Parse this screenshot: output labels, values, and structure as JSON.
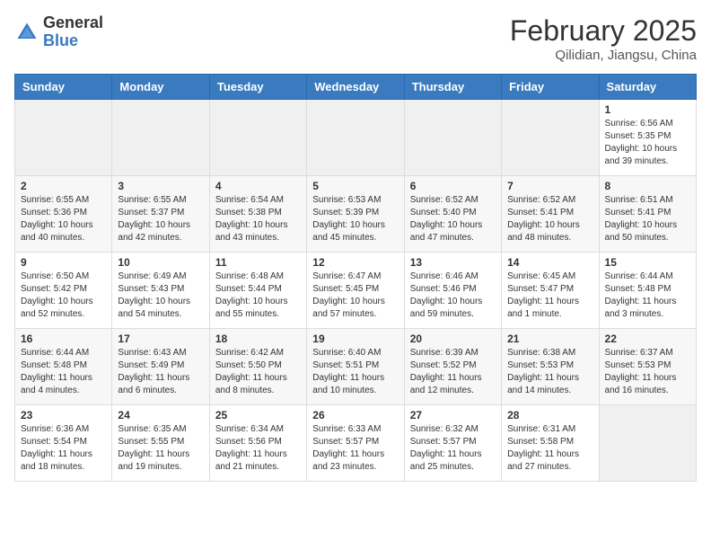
{
  "header": {
    "logo_general": "General",
    "logo_blue": "Blue",
    "month_title": "February 2025",
    "location": "Qilidian, Jiangsu, China"
  },
  "days_of_week": [
    "Sunday",
    "Monday",
    "Tuesday",
    "Wednesday",
    "Thursday",
    "Friday",
    "Saturday"
  ],
  "weeks": [
    [
      {
        "day": "",
        "info": ""
      },
      {
        "day": "",
        "info": ""
      },
      {
        "day": "",
        "info": ""
      },
      {
        "day": "",
        "info": ""
      },
      {
        "day": "",
        "info": ""
      },
      {
        "day": "",
        "info": ""
      },
      {
        "day": "1",
        "info": "Sunrise: 6:56 AM\nSunset: 5:35 PM\nDaylight: 10 hours and 39 minutes."
      }
    ],
    [
      {
        "day": "2",
        "info": "Sunrise: 6:55 AM\nSunset: 5:36 PM\nDaylight: 10 hours and 40 minutes."
      },
      {
        "day": "3",
        "info": "Sunrise: 6:55 AM\nSunset: 5:37 PM\nDaylight: 10 hours and 42 minutes."
      },
      {
        "day": "4",
        "info": "Sunrise: 6:54 AM\nSunset: 5:38 PM\nDaylight: 10 hours and 43 minutes."
      },
      {
        "day": "5",
        "info": "Sunrise: 6:53 AM\nSunset: 5:39 PM\nDaylight: 10 hours and 45 minutes."
      },
      {
        "day": "6",
        "info": "Sunrise: 6:52 AM\nSunset: 5:40 PM\nDaylight: 10 hours and 47 minutes."
      },
      {
        "day": "7",
        "info": "Sunrise: 6:52 AM\nSunset: 5:41 PM\nDaylight: 10 hours and 48 minutes."
      },
      {
        "day": "8",
        "info": "Sunrise: 6:51 AM\nSunset: 5:41 PM\nDaylight: 10 hours and 50 minutes."
      }
    ],
    [
      {
        "day": "9",
        "info": "Sunrise: 6:50 AM\nSunset: 5:42 PM\nDaylight: 10 hours and 52 minutes."
      },
      {
        "day": "10",
        "info": "Sunrise: 6:49 AM\nSunset: 5:43 PM\nDaylight: 10 hours and 54 minutes."
      },
      {
        "day": "11",
        "info": "Sunrise: 6:48 AM\nSunset: 5:44 PM\nDaylight: 10 hours and 55 minutes."
      },
      {
        "day": "12",
        "info": "Sunrise: 6:47 AM\nSunset: 5:45 PM\nDaylight: 10 hours and 57 minutes."
      },
      {
        "day": "13",
        "info": "Sunrise: 6:46 AM\nSunset: 5:46 PM\nDaylight: 10 hours and 59 minutes."
      },
      {
        "day": "14",
        "info": "Sunrise: 6:45 AM\nSunset: 5:47 PM\nDaylight: 11 hours and 1 minute."
      },
      {
        "day": "15",
        "info": "Sunrise: 6:44 AM\nSunset: 5:48 PM\nDaylight: 11 hours and 3 minutes."
      }
    ],
    [
      {
        "day": "16",
        "info": "Sunrise: 6:44 AM\nSunset: 5:48 PM\nDaylight: 11 hours and 4 minutes."
      },
      {
        "day": "17",
        "info": "Sunrise: 6:43 AM\nSunset: 5:49 PM\nDaylight: 11 hours and 6 minutes."
      },
      {
        "day": "18",
        "info": "Sunrise: 6:42 AM\nSunset: 5:50 PM\nDaylight: 11 hours and 8 minutes."
      },
      {
        "day": "19",
        "info": "Sunrise: 6:40 AM\nSunset: 5:51 PM\nDaylight: 11 hours and 10 minutes."
      },
      {
        "day": "20",
        "info": "Sunrise: 6:39 AM\nSunset: 5:52 PM\nDaylight: 11 hours and 12 minutes."
      },
      {
        "day": "21",
        "info": "Sunrise: 6:38 AM\nSunset: 5:53 PM\nDaylight: 11 hours and 14 minutes."
      },
      {
        "day": "22",
        "info": "Sunrise: 6:37 AM\nSunset: 5:53 PM\nDaylight: 11 hours and 16 minutes."
      }
    ],
    [
      {
        "day": "23",
        "info": "Sunrise: 6:36 AM\nSunset: 5:54 PM\nDaylight: 11 hours and 18 minutes."
      },
      {
        "day": "24",
        "info": "Sunrise: 6:35 AM\nSunset: 5:55 PM\nDaylight: 11 hours and 19 minutes."
      },
      {
        "day": "25",
        "info": "Sunrise: 6:34 AM\nSunset: 5:56 PM\nDaylight: 11 hours and 21 minutes."
      },
      {
        "day": "26",
        "info": "Sunrise: 6:33 AM\nSunset: 5:57 PM\nDaylight: 11 hours and 23 minutes."
      },
      {
        "day": "27",
        "info": "Sunrise: 6:32 AM\nSunset: 5:57 PM\nDaylight: 11 hours and 25 minutes."
      },
      {
        "day": "28",
        "info": "Sunrise: 6:31 AM\nSunset: 5:58 PM\nDaylight: 11 hours and 27 minutes."
      },
      {
        "day": "",
        "info": ""
      }
    ]
  ]
}
